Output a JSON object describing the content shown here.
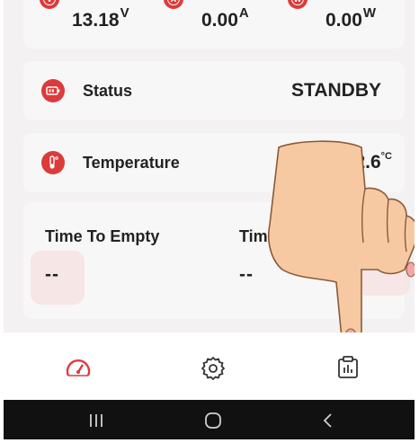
{
  "readings": {
    "voltage": {
      "value": "13.18",
      "unit": "V",
      "icon": "voltage-icon"
    },
    "current": {
      "value": "0.00",
      "unit": "A",
      "icon": "current-icon"
    },
    "power": {
      "value": "0.00",
      "unit": "W",
      "icon": "power-icon"
    }
  },
  "status": {
    "label": "Status",
    "value": "STANDBY",
    "icon": "battery-icon"
  },
  "temperature": {
    "label": "Temperature",
    "value": "2.6",
    "unit": "°C",
    "icon": "thermometer-icon"
  },
  "time": {
    "empty_label": "Time To Empty",
    "empty_value": "--",
    "second_label": "Tim",
    "second_value": "--"
  },
  "nav": [
    {
      "name": "dashboard",
      "icon": "speedometer-icon"
    },
    {
      "name": "settings",
      "icon": "gear-icon"
    },
    {
      "name": "history",
      "icon": "clipboard-chart-icon"
    }
  ],
  "system_nav": [
    {
      "name": "recents",
      "icon": "recents-icon"
    },
    {
      "name": "home",
      "icon": "home-icon"
    },
    {
      "name": "back",
      "icon": "back-icon"
    }
  ],
  "colors": {
    "accent": "#dc3b3b",
    "card": "#f8f7f7",
    "background": "#f3f1f2"
  }
}
